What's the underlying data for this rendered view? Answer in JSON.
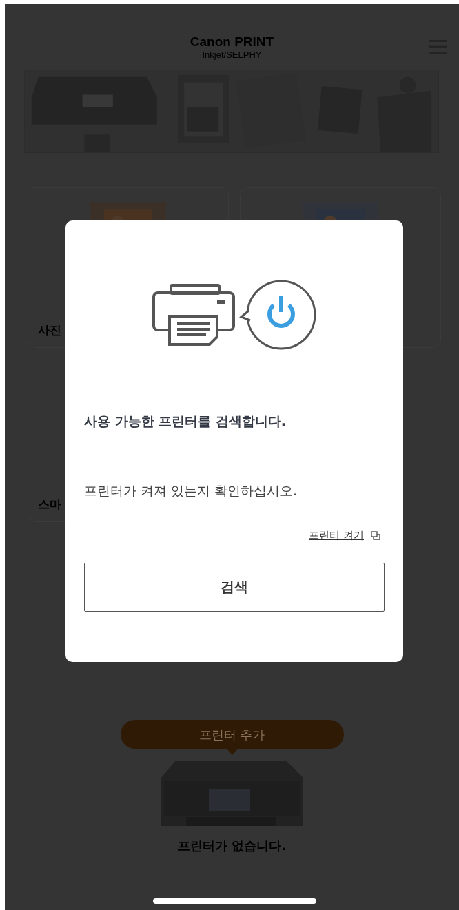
{
  "header": {
    "title": "Canon PRINT",
    "subtitle": "Inkjet/SELPHY"
  },
  "cards": [
    {
      "label": "사진"
    },
    {
      "kind": "document"
    },
    {
      "kind": "plain",
      "label": "스마"
    }
  ],
  "add_printer": {
    "label": "프린터 추가"
  },
  "no_printer": "프린터가 없습니다.",
  "dialog": {
    "title": "사용 가능한 프린터를 검색합니다.",
    "message": "프린터가 켜져 있는지 확인하십시오.",
    "link": "프린터 켜기",
    "button": "검색"
  }
}
